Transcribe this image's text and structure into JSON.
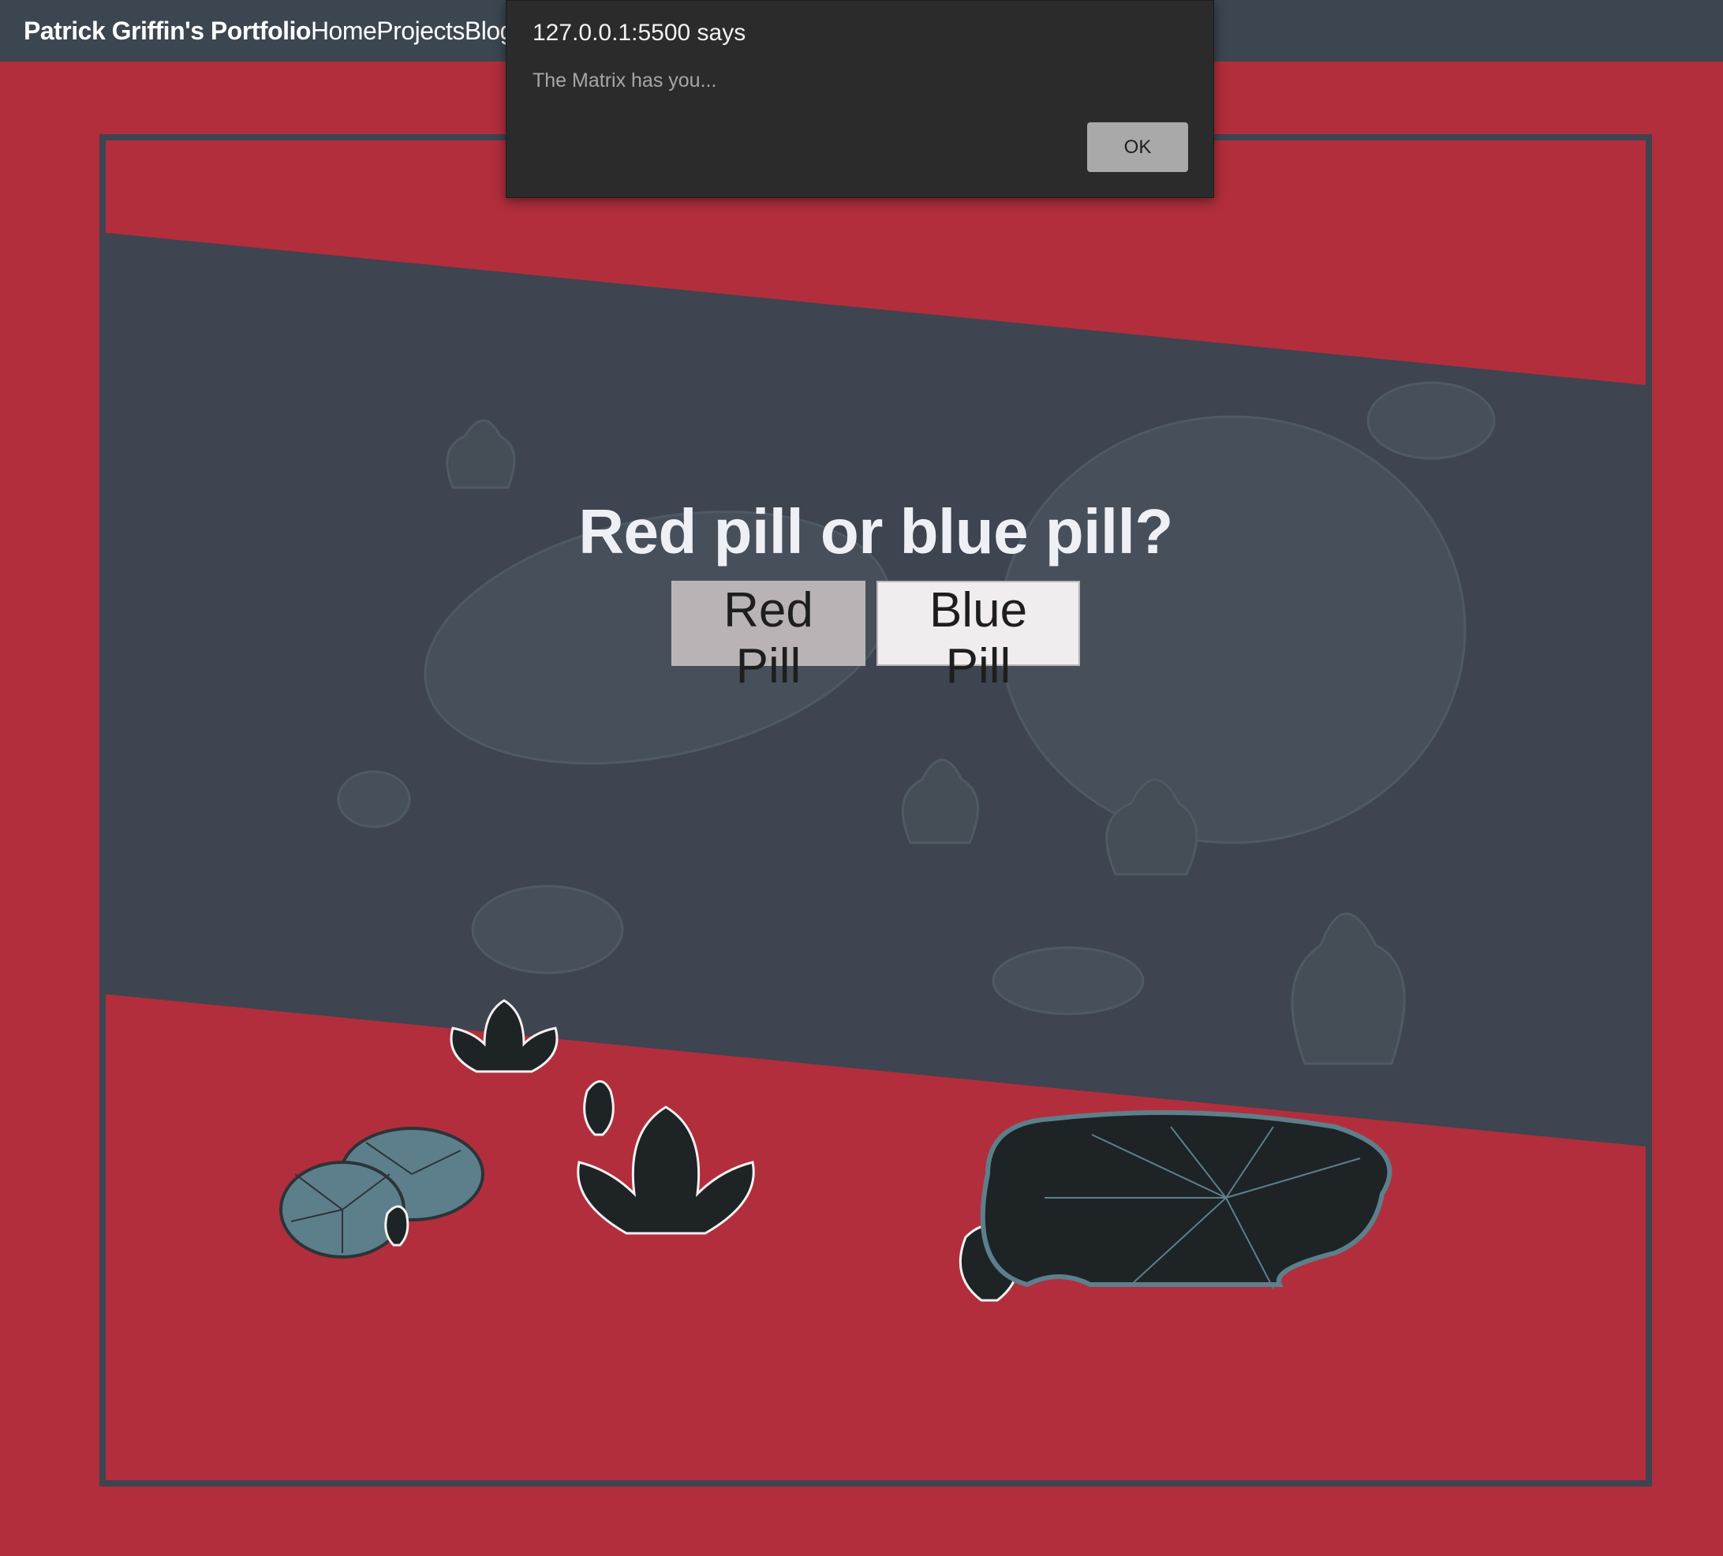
{
  "navbar": {
    "brand": "Patrick Griffin's Portfolio",
    "links": [
      "Home",
      "Projects",
      "Blog"
    ]
  },
  "hero": {
    "title": "Red pill or blue pill?",
    "buttons": {
      "red": "Red Pill",
      "blue": "Blue Pill"
    }
  },
  "alert": {
    "origin": "127.0.0.1:5500 says",
    "message": "The Matrix has you...",
    "ok_label": "OK"
  },
  "colors": {
    "background": "#b22e3c",
    "navbar": "#3b4650",
    "band": "#3e4450",
    "frame_border": "#3e4450",
    "lily_dark": "#1e2325",
    "lily_teal": "#5d7f8c",
    "dialog": "#2b2b2b"
  },
  "icons": [
    "lotus-flower-icon",
    "lily-pad-icon",
    "lotus-bud-icon"
  ]
}
